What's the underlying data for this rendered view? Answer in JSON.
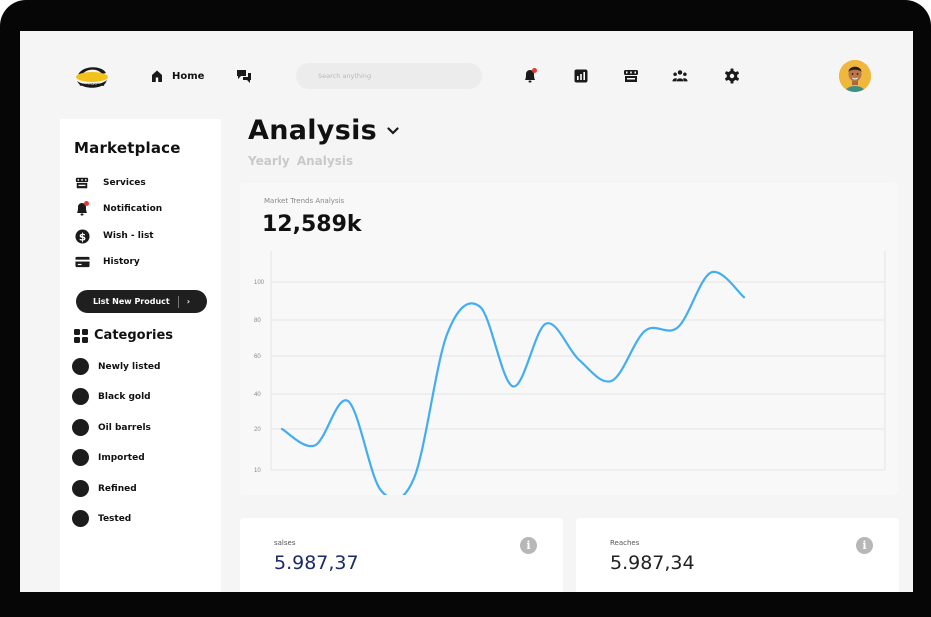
{
  "header": {
    "logo_text": "CONNECTUS",
    "home_label": "Home",
    "search_placeholder": "Search anything",
    "icons": [
      "home-icon",
      "chat-icon",
      "bell-icon",
      "chart-icon",
      "store-icon",
      "users-icon",
      "gear-icon",
      "avatar"
    ]
  },
  "sidebar": {
    "title": "Marketplace",
    "items": [
      {
        "label": "Services",
        "icon": "store-icon"
      },
      {
        "label": "Notification",
        "icon": "bell-icon"
      },
      {
        "label": "Wish - list",
        "icon": "dollar-icon"
      },
      {
        "label": "History",
        "icon": "card-icon"
      }
    ],
    "list_button": "List New Product",
    "categories_title": "Categories",
    "categories": [
      {
        "label": "Newly listed"
      },
      {
        "label": "Black gold"
      },
      {
        "label": "Oil barrels"
      },
      {
        "label": "Imported"
      },
      {
        "label": "Refined"
      },
      {
        "label": "Tested"
      }
    ]
  },
  "main": {
    "title": "Analysis",
    "subtitle": "Yearly  Analysis"
  },
  "chart_card": {
    "label": "Market Trends Analysis",
    "value": "12,589k"
  },
  "chart_data": {
    "type": "line",
    "title": "",
    "xlabel": "",
    "ylabel": "",
    "y_ticks": [
      "100",
      "80",
      "60",
      "40",
      "20",
      "10"
    ],
    "grid": true,
    "line_color": "#42adf2",
    "series": [
      {
        "values": [
          20,
          16,
          36,
          5,
          8,
          72,
          87,
          44,
          78,
          58,
          47,
          74,
          76,
          105,
          92
        ]
      }
    ]
  },
  "stats": [
    {
      "label": "salses",
      "value": "5.987,37",
      "color": "#1b2a6b"
    },
    {
      "label": "Reaches",
      "value": "5.987,34",
      "color": "#222222"
    }
  ],
  "colors": {
    "accent_line": "#42adf2",
    "notification_dot": "#e53935",
    "dark_button": "#1f1f1f"
  }
}
